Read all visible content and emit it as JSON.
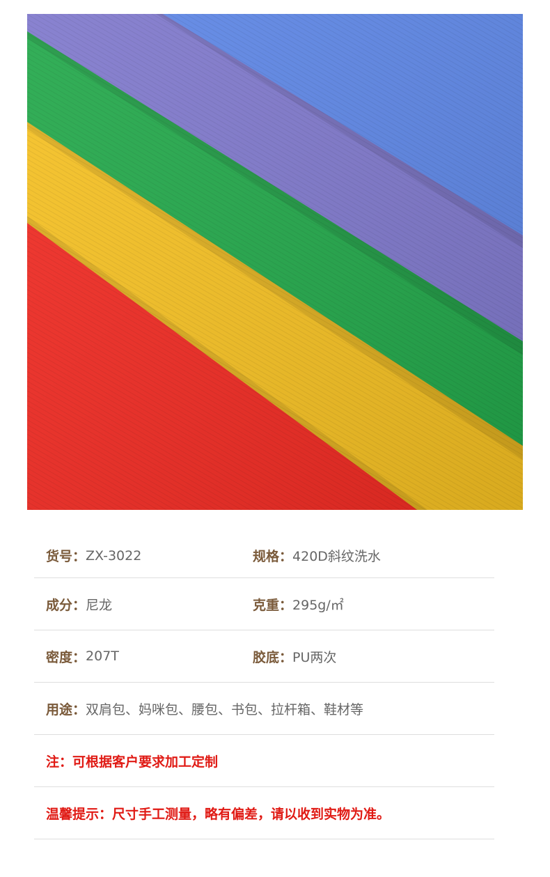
{
  "product_image": {
    "alt_colors": [
      "#5d86e6",
      "#7f78cc",
      "#22a84a",
      "#f6c122",
      "#f12a22"
    ]
  },
  "specs": {
    "item_no": {
      "label": "货号：",
      "value": "ZX-3022"
    },
    "spec": {
      "label": "规格：",
      "value": "420D斜纹洗水"
    },
    "composition": {
      "label": "成分：",
      "value": "尼龙"
    },
    "weight": {
      "label": "克重：",
      "value": "295g/㎡"
    },
    "density": {
      "label": "密度：",
      "value": "207T"
    },
    "backing": {
      "label": "胶底：",
      "value": "PU两次"
    },
    "usage": {
      "label": "用途：",
      "value": "双肩包、妈咪包、腰包、书包、拉杆箱、鞋材等"
    }
  },
  "notes": {
    "custom": "注：可根据客户要求加工定制",
    "reminder": "温馨提示：尺寸手工测量，略有偏差，请以收到实物为准。"
  },
  "colors": {
    "label_brown": "#7a5a3a",
    "value_gray": "#666666",
    "note_red": "#e01a14",
    "divider": "#dedede"
  }
}
